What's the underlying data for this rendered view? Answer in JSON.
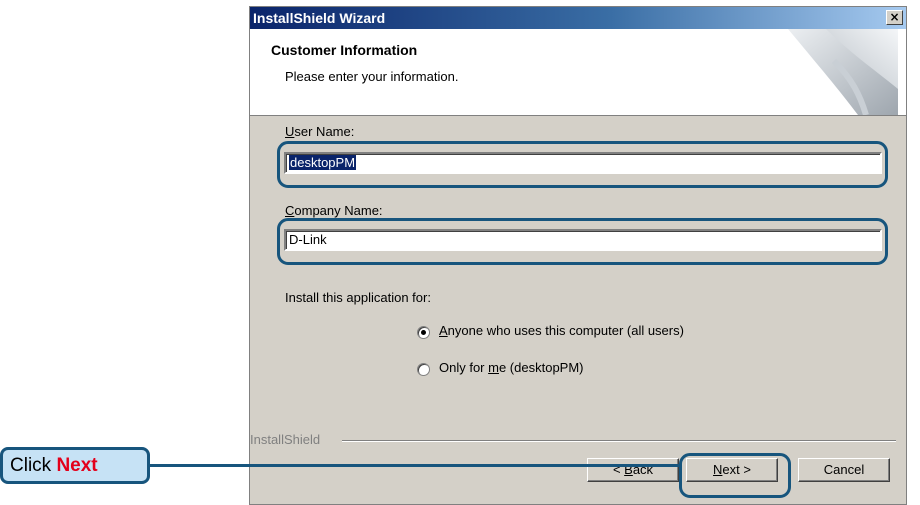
{
  "window": {
    "title": "InstallShield Wizard",
    "close_glyph": "×"
  },
  "header": {
    "title": "Customer Information",
    "subtitle": "Please enter your information."
  },
  "form": {
    "user_name_label": {
      "accel": "U",
      "rest": "ser Name:"
    },
    "user_name_value": "desktopPM",
    "company_name_label": {
      "accel": "C",
      "rest": "ompany Name:"
    },
    "company_name_value": "D-Link",
    "install_for_label": "Install this application for:",
    "options": [
      {
        "accel": "A",
        "rest": "nyone who uses this computer (all users)",
        "selected": true
      },
      {
        "before": "Only for ",
        "accel": "m",
        "after": "e (desktopPM)",
        "selected": false
      }
    ]
  },
  "footer": {
    "brand": "InstallShield",
    "back_label": {
      "accel": "B",
      "prefix": "< ",
      "rest": "ack"
    },
    "next_label": {
      "accel": "N",
      "rest": "ext >"
    },
    "cancel_label": "Cancel"
  },
  "callout": {
    "prefix": "Click ",
    "emphasis": "Next"
  },
  "colors": {
    "highlight_border": "#17557d",
    "callout_fill": "#c6e2f5",
    "callout_emphasis": "#e3001b",
    "title_bar_start": "#0a246a",
    "dialog_face": "#d4d0c8"
  }
}
